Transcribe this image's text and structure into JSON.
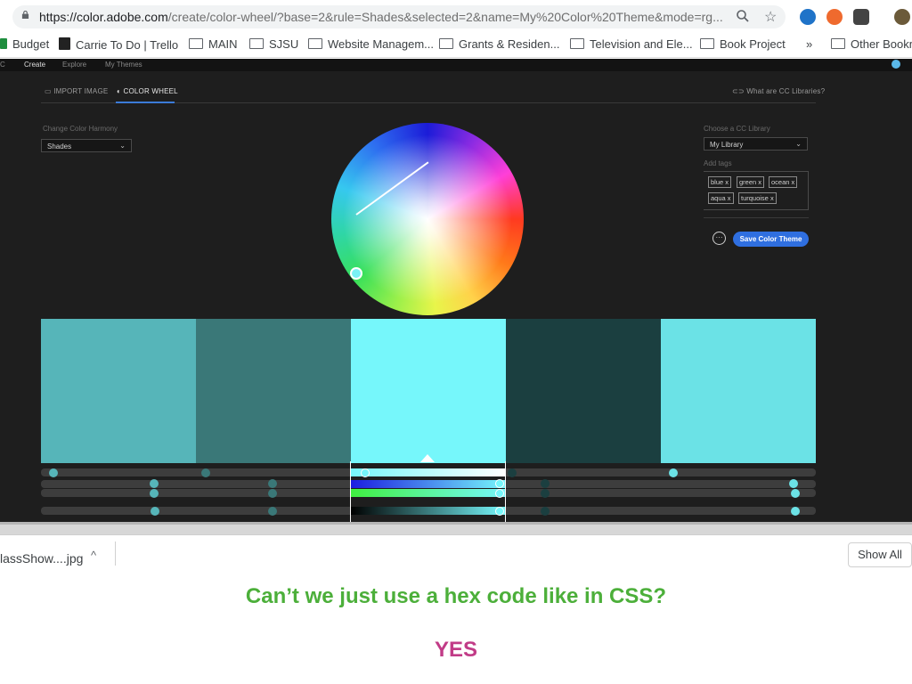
{
  "browser": {
    "url_host": "https://color.adobe.com",
    "url_path": "/create/color-wheel/?base=2&rule=Shades&selected=2&name=My%20Color%20Theme&mode=rg...",
    "bookmarks": [
      {
        "label": "Budget",
        "icon": "sheets-icon"
      },
      {
        "label": "Carrie To Do | Trello",
        "icon": "trello-icon"
      },
      {
        "label": "MAIN",
        "icon": "folder-icon"
      },
      {
        "label": "SJSU",
        "icon": "folder-icon"
      },
      {
        "label": "Website Managem...",
        "icon": "folder-icon"
      },
      {
        "label": "Grants & Residen...",
        "icon": "folder-icon"
      },
      {
        "label": "Television and Ele...",
        "icon": "folder-icon"
      },
      {
        "label": "Book Project",
        "icon": "folder-icon"
      },
      {
        "label": "»",
        "icon": "overflow-chevron"
      },
      {
        "label": "Other Bookm",
        "icon": "folder-icon"
      }
    ],
    "download_file": "lassShow....jpg",
    "download_chevron": "^",
    "show_all": "Show All"
  },
  "app": {
    "nav": {
      "logo": "C",
      "create": "Create",
      "explore": "Explore",
      "my_themes": "My Themes"
    },
    "tabs": {
      "import_image": "IMPORT IMAGE",
      "color_wheel": "COLOR WHEEL"
    },
    "libraries_link": "What are CC Libraries?",
    "harmony_label": "Change Color Harmony",
    "harmony_value": "Shades",
    "library_label": "Choose a CC Library",
    "library_value": "My Library",
    "tags_label": "Add tags",
    "tags": [
      "blue",
      "green",
      "ocean",
      "aqua",
      "turquoise"
    ],
    "more_button": "···",
    "save_button": "Save Color Theme",
    "swatches": [
      "#56b5b9",
      "#3a7878",
      "#76f7fb",
      "#1b3f40",
      "#6be2e6"
    ],
    "selected_swatch": 2,
    "accent": "#2f6fe0"
  },
  "captions": {
    "question": "Can’t we just use a hex code like in CSS?",
    "answer": "YES"
  }
}
